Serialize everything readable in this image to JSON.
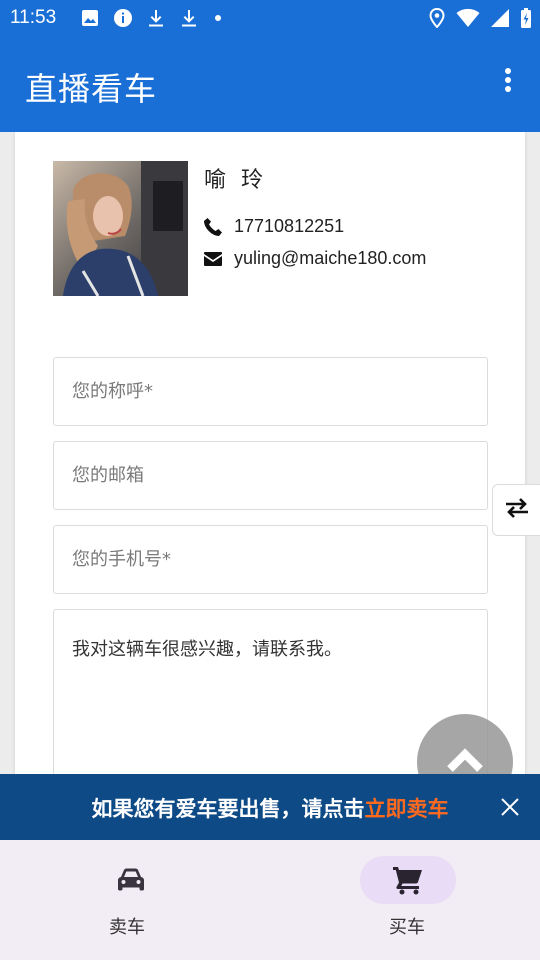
{
  "status_bar": {
    "time": "11:53",
    "left_icons": [
      "image-icon",
      "info-icon",
      "download-icon",
      "download-icon",
      "dot-icon"
    ],
    "right_icons": [
      "location-icon",
      "wifi-icon",
      "signal-icon",
      "battery-icon"
    ]
  },
  "app_bar": {
    "title": "直播看车",
    "menu_icon": "more-vert-icon"
  },
  "agent": {
    "name": "喻 玲",
    "phone": "17710812251",
    "email": "yuling@maiche180.com"
  },
  "form": {
    "name_placeholder": "您的称呼*",
    "email_placeholder": "您的邮箱",
    "phone_placeholder": "您的手机号*",
    "message_value": "我对这辆车很感兴趣，请联系我。"
  },
  "promo": {
    "text": "如果您有爱车要出售，请点击",
    "link_text": "立即卖车",
    "highlight_color": "#ff6a1f"
  },
  "bottom_nav": {
    "items": [
      {
        "label": "卖车",
        "icon": "car-icon"
      },
      {
        "label": "买车",
        "icon": "cart-icon",
        "selected": true
      }
    ]
  },
  "colors": {
    "primary": "#1a6fd6",
    "banner": "#0e4a86",
    "nav_background": "#f2ecf5",
    "nav_selected": "#e8dcf6"
  }
}
